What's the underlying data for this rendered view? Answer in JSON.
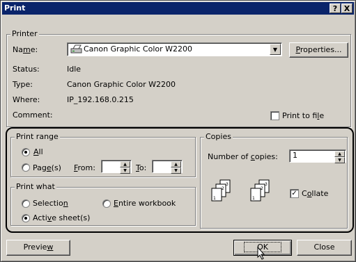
{
  "title": "Print",
  "title_buttons": {
    "help": "?",
    "close": "X"
  },
  "printer": {
    "group_label": "Printer",
    "name_label": "Name:",
    "name_value": "Canon Graphic Color W2200",
    "properties_button": "Properties...",
    "status_label": "Status:",
    "status_value": "Idle",
    "type_label": "Type:",
    "type_value": "Canon Graphic Color W2200",
    "where_label": "Where:",
    "where_value": "IP_192.168.0.215",
    "comment_label": "Comment:",
    "print_to_file": "Print to file",
    "print_to_file_checked": false
  },
  "print_range": {
    "group_label": "Print range",
    "all": "All",
    "pages": "Page(s)",
    "from": "From:",
    "to": "To:",
    "selected": "all"
  },
  "print_what": {
    "group_label": "Print what",
    "selection": "Selection",
    "entire_workbook": "Entire workbook",
    "active_sheets": "Active sheet(s)",
    "selected": "active_sheets"
  },
  "copies": {
    "group_label": "Copies",
    "number_label": "Number of copies:",
    "number_value": "1",
    "collate": "Collate",
    "collate_checked": true
  },
  "buttons": {
    "preview": "Preview",
    "ok": "OK",
    "close": "Close"
  },
  "icons": {
    "printer": "printer-icon",
    "cursor": "mouse-pointer-icon"
  }
}
